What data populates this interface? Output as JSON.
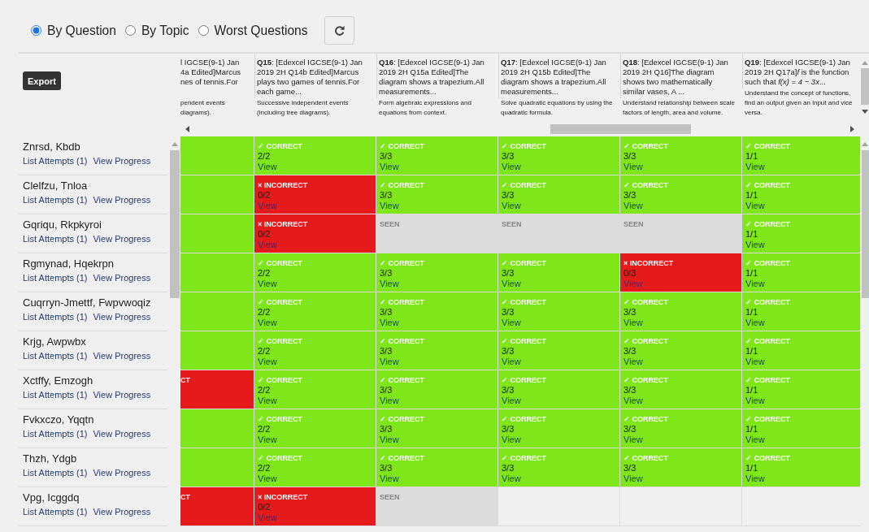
{
  "view_modes": [
    {
      "label": "By Question",
      "selected": true
    },
    {
      "label": "By Topic",
      "selected": false
    },
    {
      "label": "Worst Questions",
      "selected": false
    }
  ],
  "export_button": "Export",
  "partial_column": {
    "title_lines": [
      "l IGCSE(9-1) Jan",
      "4a Edited]Marcus",
      "nes of tennis.For"
    ],
    "topic_lines": [
      "pendent events",
      "diagrams)."
    ]
  },
  "columns": [
    {
      "title": "**Q15**: [Edexcel IGCSE(9-1) Jan 2019 2H Q14b Edited]Marcus plays two games of tennis.For each game...",
      "topic": "Successive independent events (including tree diagrams)."
    },
    {
      "title": "**Q16**: [Edexcel IGCSE(9-1) Jan 2019 2H Q15a Edited]The diagram shows a trapezium.All measurements...",
      "topic": "Form algebraic expressions and equations from context."
    },
    {
      "title": "**Q17**: [Edexcel IGCSE(9-1) Jan 2019 2H Q15b Edited]The diagram shows a trapezium.All measurements...",
      "topic": "Solve quadratic equations by using the quadratic formula."
    },
    {
      "title": "**Q18**: [Edexcel IGCSE(9-1) Jan 2019 2H Q16]The diagram shows two mathematically similar vases, A ...",
      "topic": "Understand relationship between scale factors of length, area and volume."
    },
    {
      "title": "**Q19**: [Edexcel IGCSE(9-1) Jan 2019 2H Q17a]*f* is the function such that *f(x) = 4 − 3x*...",
      "topic": "Understand the concept of functions, find an output given an input and vice versa."
    }
  ],
  "students": [
    {
      "name": "Znrsd, Kbdb",
      "attempts_link": "List Attempts (1)",
      "progress_link": "View Progress",
      "partial_cell": {
        "kind": "correct"
      },
      "cells": [
        {
          "kind": "correct",
          "label": "✓ CORRECT",
          "score": "2/2",
          "link": "View"
        },
        {
          "kind": "correct",
          "label": "✓ CORRECT",
          "score": "3/3",
          "link": "View"
        },
        {
          "kind": "correct",
          "label": "✓ CORRECT",
          "score": "3/3",
          "link": "View"
        },
        {
          "kind": "correct",
          "label": "✓ CORRECT",
          "score": "3/3",
          "link": "View"
        },
        {
          "kind": "correct",
          "label": "✓ CORRECT",
          "score": "1/1",
          "link": "View"
        }
      ]
    },
    {
      "name": "Clelfzu, Tnloa",
      "attempts_link": "List Attempts (1)",
      "progress_link": "View Progress",
      "partial_cell": {
        "kind": "correct"
      },
      "cells": [
        {
          "kind": "incorrect",
          "label": "× INCORRECT",
          "score": "0/2",
          "link": "View"
        },
        {
          "kind": "correct",
          "label": "✓ CORRECT",
          "score": "3/3",
          "link": "View"
        },
        {
          "kind": "correct",
          "label": "✓ CORRECT",
          "score": "3/3",
          "link": "View"
        },
        {
          "kind": "correct",
          "label": "✓ CORRECT",
          "score": "3/3",
          "link": "View"
        },
        {
          "kind": "correct",
          "label": "✓ CORRECT",
          "score": "1/1",
          "link": "View"
        }
      ]
    },
    {
      "name": "Gqriqu, Rkpkyroi",
      "attempts_link": "List Attempts (1)",
      "progress_link": "View Progress",
      "partial_cell": {
        "kind": "correct"
      },
      "cells": [
        {
          "kind": "incorrect",
          "label": "× INCORRECT",
          "score": "0/2",
          "link": "View"
        },
        {
          "kind": "seen",
          "label": "SEEN"
        },
        {
          "kind": "seen",
          "label": "SEEN"
        },
        {
          "kind": "seen",
          "label": "SEEN"
        },
        {
          "kind": "correct",
          "label": "✓ CORRECT",
          "score": "1/1",
          "link": "View"
        }
      ]
    },
    {
      "name": "Rgmynad, Hqekrpn",
      "attempts_link": "List Attempts (1)",
      "progress_link": "View Progress",
      "partial_cell": {
        "kind": "correct"
      },
      "cells": [
        {
          "kind": "correct",
          "label": "✓ CORRECT",
          "score": "2/2",
          "link": "View"
        },
        {
          "kind": "correct",
          "label": "✓ CORRECT",
          "score": "3/3",
          "link": "View"
        },
        {
          "kind": "correct",
          "label": "✓ CORRECT",
          "score": "3/3",
          "link": "View"
        },
        {
          "kind": "incorrect",
          "label": "× INCORRECT",
          "score": "0/3",
          "link": "View"
        },
        {
          "kind": "correct",
          "label": "✓ CORRECT",
          "score": "1/1",
          "link": "View"
        }
      ]
    },
    {
      "name": "Cuqrryn-Jmettf, Fwpvwoqiz",
      "attempts_link": "List Attempts (1)",
      "progress_link": "View Progress",
      "partial_cell": {
        "kind": "correct"
      },
      "cells": [
        {
          "kind": "correct",
          "label": "✓ CORRECT",
          "score": "2/2",
          "link": "View"
        },
        {
          "kind": "correct",
          "label": "✓ CORRECT",
          "score": "3/3",
          "link": "View"
        },
        {
          "kind": "correct",
          "label": "✓ CORRECT",
          "score": "3/3",
          "link": "View"
        },
        {
          "kind": "correct",
          "label": "✓ CORRECT",
          "score": "3/3",
          "link": "View"
        },
        {
          "kind": "correct",
          "label": "✓ CORRECT",
          "score": "1/1",
          "link": "View"
        }
      ]
    },
    {
      "name": "Krjg, Awpwbx",
      "attempts_link": "List Attempts (1)",
      "progress_link": "View Progress",
      "partial_cell": {
        "kind": "correct"
      },
      "cells": [
        {
          "kind": "correct",
          "label": "✓ CORRECT",
          "score": "2/2",
          "link": "View"
        },
        {
          "kind": "correct",
          "label": "✓ CORRECT",
          "score": "3/3",
          "link": "View"
        },
        {
          "kind": "correct",
          "label": "✓ CORRECT",
          "score": "3/3",
          "link": "View"
        },
        {
          "kind": "correct",
          "label": "✓ CORRECT",
          "score": "3/3",
          "link": "View"
        },
        {
          "kind": "correct",
          "label": "✓ CORRECT",
          "score": "1/1",
          "link": "View"
        }
      ]
    },
    {
      "name": "Xctffy, Emzogh",
      "attempts_link": "List Attempts (1)",
      "progress_link": "View Progress",
      "partial_cell": {
        "kind": "incorrect",
        "label": "CT"
      },
      "cells": [
        {
          "kind": "correct",
          "label": "✓ CORRECT",
          "score": "2/2",
          "link": "View"
        },
        {
          "kind": "correct",
          "label": "✓ CORRECT",
          "score": "3/3",
          "link": "View"
        },
        {
          "kind": "correct",
          "label": "✓ CORRECT",
          "score": "3/3",
          "link": "View"
        },
        {
          "kind": "correct",
          "label": "✓ CORRECT",
          "score": "3/3",
          "link": "View"
        },
        {
          "kind": "correct",
          "label": "✓ CORRECT",
          "score": "1/1",
          "link": "View"
        }
      ]
    },
    {
      "name": "Fvkxczo, Yqqtn",
      "attempts_link": "List Attempts (1)",
      "progress_link": "View Progress",
      "partial_cell": {
        "kind": "correct"
      },
      "cells": [
        {
          "kind": "correct",
          "label": "✓ CORRECT",
          "score": "2/2",
          "link": "View"
        },
        {
          "kind": "correct",
          "label": "✓ CORRECT",
          "score": "3/3",
          "link": "View"
        },
        {
          "kind": "correct",
          "label": "✓ CORRECT",
          "score": "3/3",
          "link": "View"
        },
        {
          "kind": "correct",
          "label": "✓ CORRECT",
          "score": "3/3",
          "link": "View"
        },
        {
          "kind": "correct",
          "label": "✓ CORRECT",
          "score": "1/1",
          "link": "View"
        }
      ]
    },
    {
      "name": "Thzh, Ydgb",
      "attempts_link": "List Attempts (1)",
      "progress_link": "View Progress",
      "partial_cell": {
        "kind": "correct"
      },
      "cells": [
        {
          "kind": "correct",
          "label": "✓ CORRECT",
          "score": "2/2",
          "link": "View"
        },
        {
          "kind": "correct",
          "label": "✓ CORRECT",
          "score": "3/3",
          "link": "View"
        },
        {
          "kind": "correct",
          "label": "✓ CORRECT",
          "score": "3/3",
          "link": "View"
        },
        {
          "kind": "correct",
          "label": "✓ CORRECT",
          "score": "3/3",
          "link": "View"
        },
        {
          "kind": "correct",
          "label": "✓ CORRECT",
          "score": "1/1",
          "link": "View"
        }
      ]
    },
    {
      "name": "Vpg, Icggdq",
      "attempts_link": "List Attempts (1)",
      "progress_link": "View Progress",
      "partial_cell": {
        "kind": "incorrect",
        "label": "CT"
      },
      "cells": [
        {
          "kind": "incorrect",
          "label": "× INCORRECT",
          "score": "0/2",
          "link": "View"
        },
        {
          "kind": "seen",
          "label": "SEEN"
        },
        {
          "kind": "none"
        },
        {
          "kind": "none"
        },
        {
          "kind": "none"
        }
      ]
    }
  ]
}
